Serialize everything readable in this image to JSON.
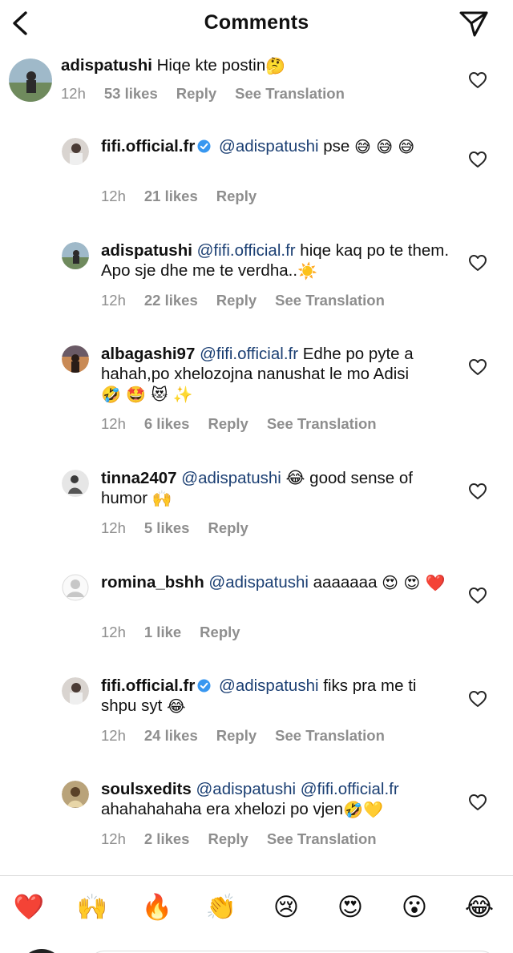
{
  "header": {
    "title": "Comments"
  },
  "comments": [
    {
      "username": "adispatushi",
      "verified": false,
      "level": "top",
      "text": "Hiqe kte postin",
      "emoji_suffix": "🤔",
      "time": "12h",
      "likes": "53 likes",
      "reply": "Reply",
      "translation": "See Translation"
    },
    {
      "username": "fifi.official.fr",
      "verified": true,
      "level": "reply",
      "mention": "@adispatushi",
      "text": "pse",
      "emoji_suffix": "😅 😅 😅",
      "time": "12h",
      "likes": "21 likes",
      "reply": "Reply",
      "translation": ""
    },
    {
      "username": "adispatushi",
      "verified": false,
      "level": "reply",
      "mention": "@fifi.official.fr",
      "text": "hiqe kaq po te them. Apo sje dhe me te verdha..",
      "emoji_suffix": "☀️",
      "time": "12h",
      "likes": "22 likes",
      "reply": "Reply",
      "translation": "See Translation"
    },
    {
      "username": "albagashi97",
      "verified": false,
      "level": "reply",
      "mention": "@fifi.official.fr",
      "text": "Edhe po pyte a hahah,po xhelozojna nanushat le mo Adisi",
      "emoji_suffix": "🤣 🤩 😻 ✨",
      "time": "12h",
      "likes": "6 likes",
      "reply": "Reply",
      "translation": "See Translation"
    },
    {
      "username": "tinna2407",
      "verified": false,
      "level": "reply",
      "mention": "@adispatushi",
      "text": "😂 good sense of humor",
      "emoji_suffix": "🙌",
      "time": "12h",
      "likes": "5 likes",
      "reply": "Reply",
      "translation": ""
    },
    {
      "username": "romina_bshh",
      "verified": false,
      "level": "reply",
      "mention": "@adispatushi",
      "text": "aaaaaaa",
      "emoji_suffix": "😍 😍 ❤️",
      "time": "12h",
      "likes": "1 like",
      "reply": "Reply",
      "translation": ""
    },
    {
      "username": "fifi.official.fr",
      "verified": true,
      "level": "reply",
      "mention": "@adispatushi",
      "text": "fiks pra me ti shpu syt",
      "emoji_suffix": "😂",
      "time": "12h",
      "likes": "24 likes",
      "reply": "Reply",
      "translation": "See Translation"
    },
    {
      "username": "soulsxedits",
      "verified": false,
      "level": "reply",
      "mention": "@adispatushi  @fifi.official.fr",
      "text": "ahahahahaha era xhelozi po vjen",
      "emoji_suffix": "🤣💛",
      "time": "12h",
      "likes": "2 likes",
      "reply": "Reply",
      "translation": "See Translation"
    }
  ],
  "emoji_bar": [
    "❤️",
    "🙌",
    "🔥",
    "👏",
    "😢",
    "😍",
    "😮",
    "😂"
  ],
  "icons": {
    "back": "chevron-left-icon",
    "send": "paper-plane-icon",
    "heart": "heart-outline-icon",
    "verified": "verified-badge-icon"
  },
  "colors": {
    "mention": "#1b3f73",
    "meta": "#8e8e8e",
    "verified": "#3897f0"
  }
}
